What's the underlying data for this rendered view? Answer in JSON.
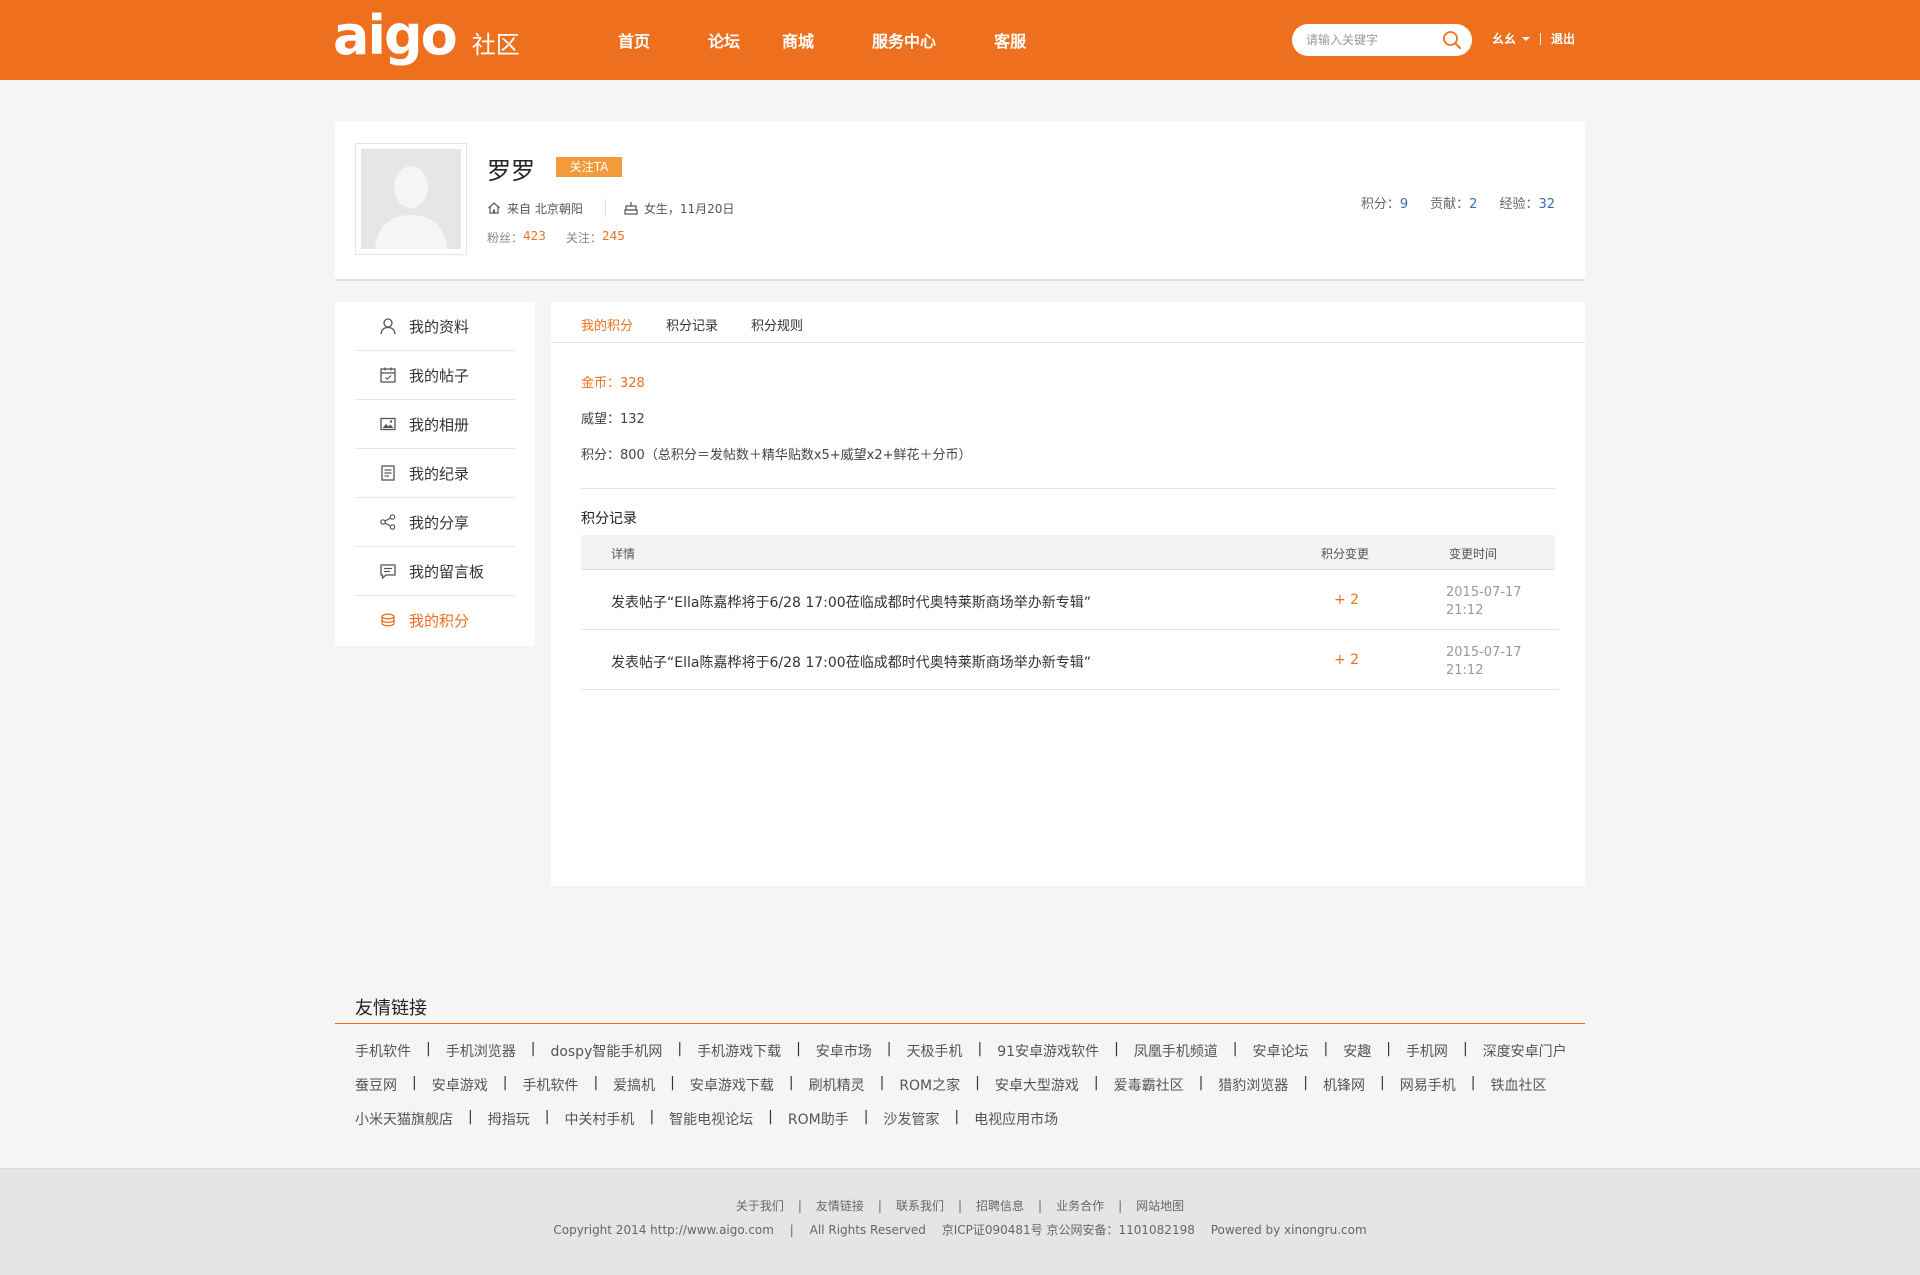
{
  "header": {
    "logo_text": "aigo",
    "logo_sub": "社区",
    "nav": [
      "首页",
      "论坛",
      "商城",
      "服务中心",
      "客服"
    ],
    "search_placeholder": "请输入关键字",
    "username": "幺幺",
    "logout": "退出",
    "brand_color": "#ee6f1d"
  },
  "profile": {
    "name": "罗罗",
    "follow_label": "关注TA",
    "location": "来自 北京朝阳",
    "gender_birthday": "女生，11月20日",
    "fans_label": "粉丝：",
    "fans_value": "423",
    "following_label": "关注：",
    "following_value": "245",
    "score_label": "积分：",
    "score_value": "9",
    "contribution_label": "贡献：",
    "contribution_value": "2",
    "experience_label": "经验：",
    "experience_value": "32"
  },
  "sidebar": {
    "items": [
      {
        "label": "我的资料",
        "icon": "user-icon"
      },
      {
        "label": "我的帖子",
        "icon": "calendar-icon"
      },
      {
        "label": "我的相册",
        "icon": "image-icon"
      },
      {
        "label": "我的纪录",
        "icon": "document-icon"
      },
      {
        "label": "我的分享",
        "icon": "share-icon"
      },
      {
        "label": "我的留言板",
        "icon": "message-icon"
      },
      {
        "label": "我的积分",
        "icon": "coins-icon"
      }
    ],
    "active_index": 6
  },
  "main": {
    "tabs": [
      "我的积分",
      "积分记录",
      "积分规则"
    ],
    "active_tab": 0,
    "gold_line": "金币：328",
    "prestige_line": "威望：132",
    "points_line": "积分：800（总积分＝发帖数＋精华贴数x5+威望x2+鲜花＋分币）",
    "records_title": "积分记录",
    "table": {
      "headers": [
        "详情",
        "积分变更",
        "变更时间"
      ],
      "rows": [
        {
          "detail": "发表帖子“Ella陈嘉桦将于6/28 17:00莅临成都时代奥特莱斯商场举办新专辑”",
          "change": "+ 2",
          "date": "2015-07-17",
          "time": "21:12"
        },
        {
          "detail": "发表帖子“Ella陈嘉桦将于6/28 17:00莅临成都时代奥特莱斯商场举办新专辑”",
          "change": "+ 2",
          "date": "2015-07-17",
          "time": "21:12"
        }
      ]
    }
  },
  "friend_links": {
    "title": "友情链接",
    "rows": [
      [
        "手机软件",
        "手机浏览器",
        "dospy智能手机网",
        "手机游戏下载",
        "安卓市场",
        "天极手机",
        "91安卓游戏软件",
        "凤凰手机频道",
        "安卓论坛",
        "安趣",
        "手机网",
        "深度安卓门户"
      ],
      [
        "蚕豆网",
        "安卓游戏",
        "手机软件",
        "爱搞机",
        "安卓游戏下载",
        "刷机精灵",
        "ROM之家",
        "安卓大型游戏",
        "爱毒霸社区",
        "猎豹浏览器",
        "机锋网",
        "网易手机",
        "铁血社区"
      ],
      [
        "小米天猫旗舰店",
        "拇指玩",
        "中关村手机",
        "智能电视论坛",
        "ROM助手",
        "沙发管家",
        "电视应用市场"
      ]
    ]
  },
  "footer": {
    "links": [
      "关于我们",
      "友情链接",
      "联系我们",
      "招聘信息",
      "业务合作",
      "网站地图"
    ],
    "copyright": "Copyright 2014 http://www.aigo.com",
    "rights": "All Rights Reserved",
    "icp": "京ICP证090481号 京公网安备：1101082198",
    "powered": "Powered by xinongru.com"
  }
}
